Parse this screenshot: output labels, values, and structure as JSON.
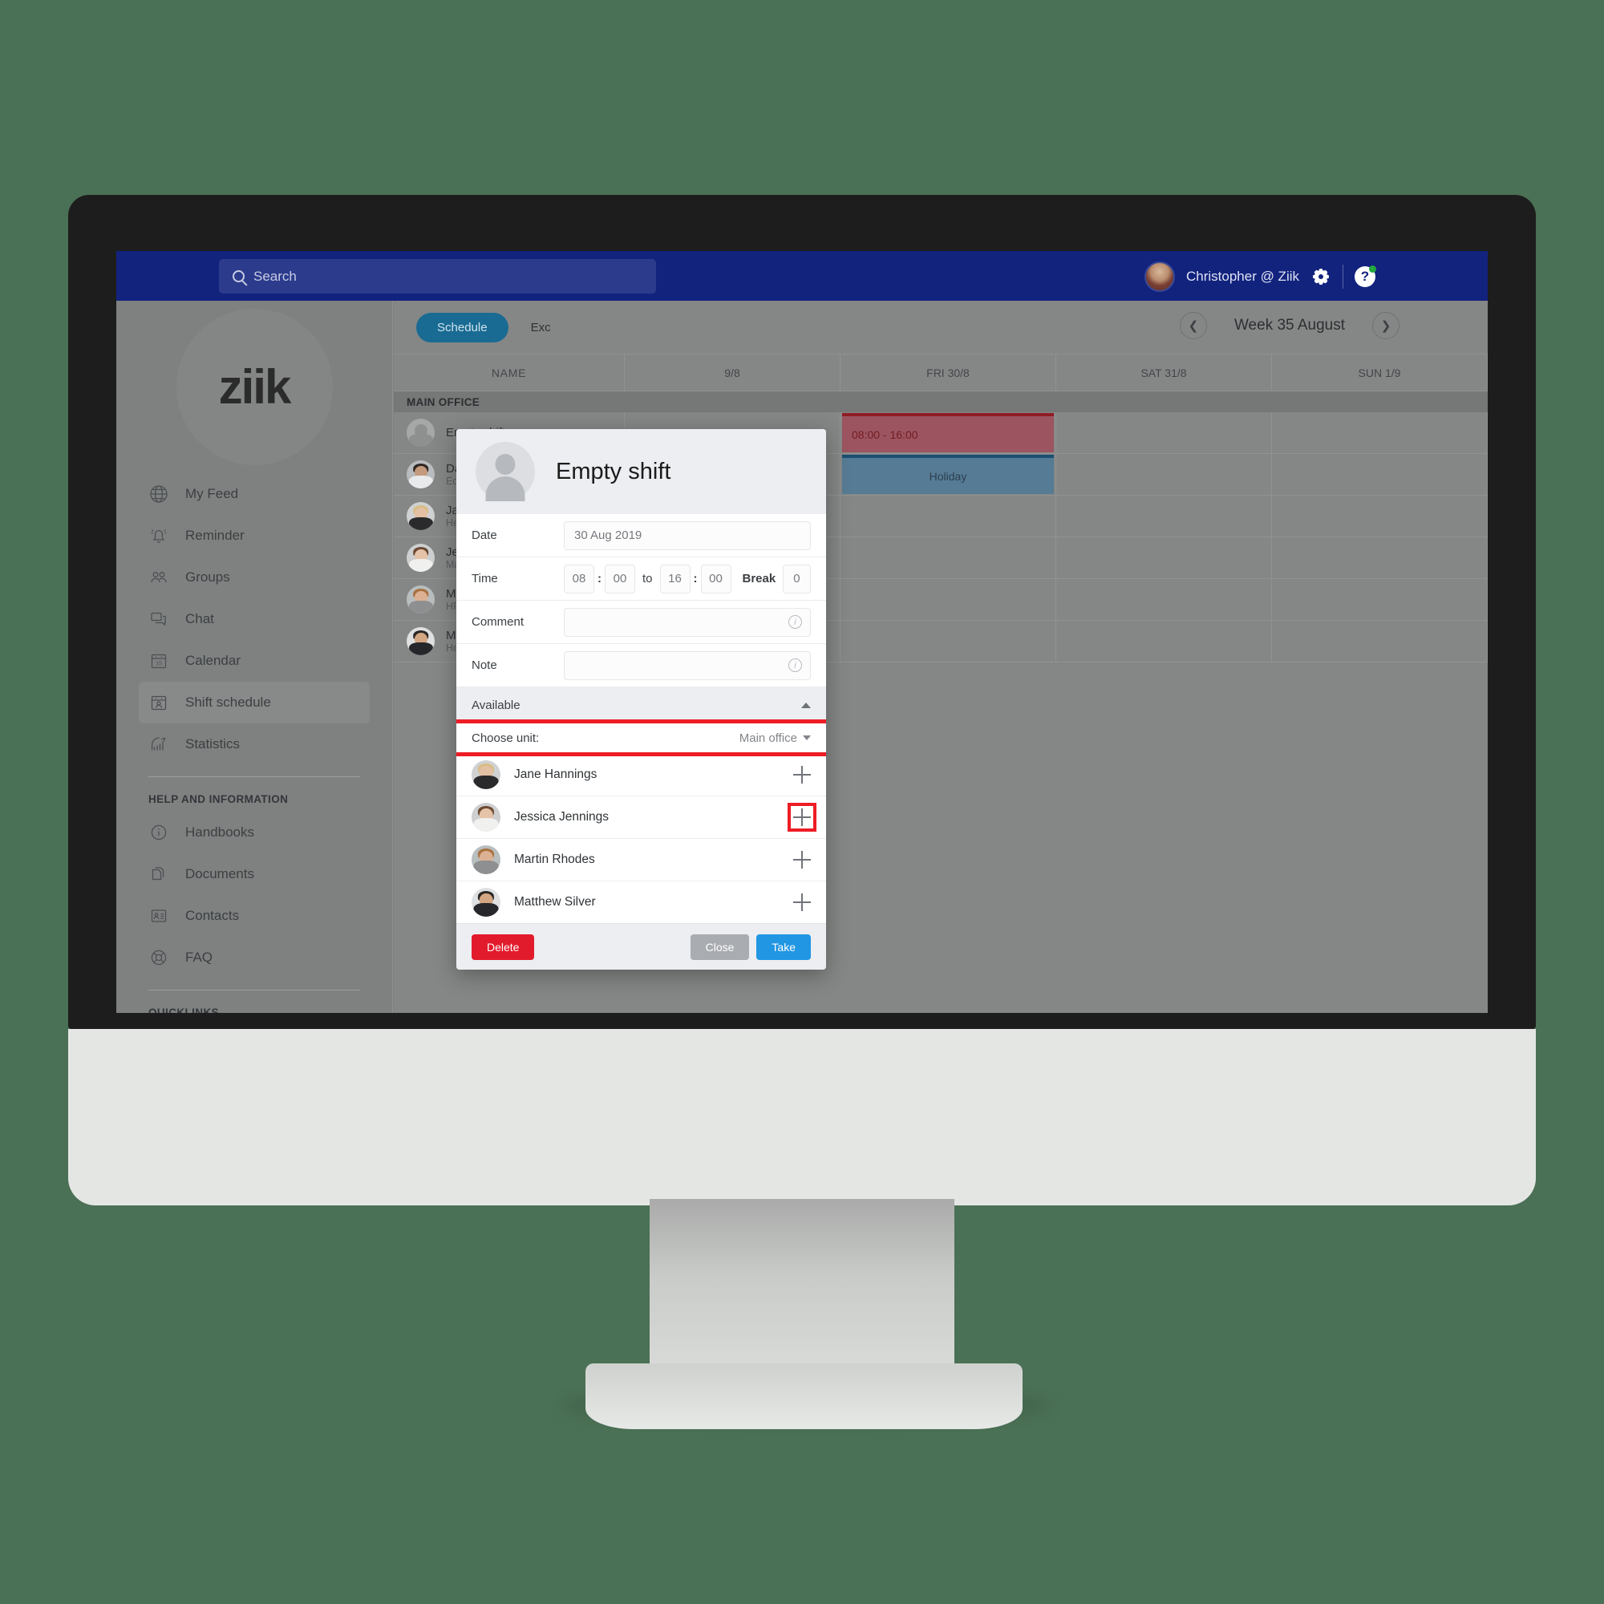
{
  "topbar": {
    "search_placeholder": "Search",
    "search_icon": "search-icon",
    "user_name": "Christopher @ Ziik",
    "gear_icon": "gear-icon",
    "help_icon": "help-icon",
    "help_glyph": "?"
  },
  "sidebar": {
    "logo": "ziik",
    "items": [
      {
        "label": "My Feed",
        "icon": "globe-icon"
      },
      {
        "label": "Reminder",
        "icon": "bell-icon"
      },
      {
        "label": "Groups",
        "icon": "people-icon"
      },
      {
        "label": "Chat",
        "icon": "chat-icon"
      },
      {
        "label": "Calendar",
        "icon": "calendar-icon",
        "day": "15"
      },
      {
        "label": "Shift schedule",
        "icon": "shift-schedule-icon"
      },
      {
        "label": "Statistics",
        "icon": "statistics-icon"
      }
    ],
    "help_section_title": "HELP AND INFORMATION",
    "help_items": [
      {
        "label": "Handbooks",
        "icon": "info-circle-icon"
      },
      {
        "label": "Documents",
        "icon": "documents-icon"
      },
      {
        "label": "Contacts",
        "icon": "contact-card-icon"
      },
      {
        "label": "FAQ",
        "icon": "lifebuoy-icon"
      }
    ],
    "quicklinks_title": "QUICKLINKS"
  },
  "toolbar": {
    "tab_schedule": "Schedule",
    "tab_exchange": "Exc",
    "prev_icon": "chevron-left-icon",
    "next_icon": "chevron-right-icon",
    "week_label": "Week 35 August"
  },
  "schedule": {
    "col_name": "NAME",
    "days": [
      "9/8",
      "FRI 30/8",
      "SAT 31/8",
      "SUN 1/9"
    ],
    "group_label": "MAIN OFFICE",
    "rows": [
      {
        "name": "Empty shift",
        "role": "",
        "avatar": "placeholder-avatar"
      },
      {
        "name": "Dan Yung",
        "role": "Economy",
        "avatar": "dan-yung-avatar"
      },
      {
        "name": "Jane Hannings",
        "role": "Head of sales",
        "avatar": "jane-hannings-avatar"
      },
      {
        "name": "Jessica Jennings",
        "role": "Marketing",
        "avatar": "jessica-jennings-avatar"
      },
      {
        "name": "Martin Rhodes",
        "role": "HR",
        "avatar": "martin-rhodes-avatar"
      },
      {
        "name": "Matthew Silver",
        "role": "Head of supplies",
        "avatar": "matthew-silver-avatar"
      }
    ],
    "shift_block": "08:00 - 16:00",
    "holiday_block": "Holiday"
  },
  "modal": {
    "title": "Empty shift",
    "avatar": "placeholder-avatar",
    "fields": {
      "date_label": "Date",
      "date_value": "30 Aug 2019",
      "time_label": "Time",
      "time_from_h": "08",
      "time_from_m": "00",
      "time_to_word": "to",
      "time_to_h": "16",
      "time_to_m": "00",
      "break_label": "Break",
      "break_value": "0",
      "comment_label": "Comment",
      "comment_value": "",
      "note_label": "Note",
      "note_value": ""
    },
    "available_label": "Available",
    "available_caret": "caret-up-icon",
    "unit_label": "Choose unit:",
    "unit_value": "Main office",
    "unit_caret": "caret-down-icon",
    "available_people": [
      {
        "name": "Jane Hannings",
        "avatar": "jane-hannings-avatar",
        "add_icon": "plus-icon"
      },
      {
        "name": "Jessica Jennings",
        "avatar": "jessica-jennings-avatar",
        "add_icon": "plus-icon"
      },
      {
        "name": "Martin Rhodes",
        "avatar": "martin-rhodes-avatar",
        "add_icon": "plus-icon"
      },
      {
        "name": "Matthew Silver",
        "avatar": "matthew-silver-avatar",
        "add_icon": "plus-icon"
      }
    ],
    "footer": {
      "delete_label": "Delete",
      "close_label": "Close",
      "take_label": "Take"
    }
  },
  "colors": {
    "header_blue": "#12237e",
    "accent_teal": "#1a6b93",
    "highlight_red": "#ee1c25",
    "delete_red": "#e21b2c",
    "take_blue": "#2196e3",
    "shift_red": "#9c5560",
    "holiday_blue": "#567b94",
    "page_background": "#4a7055"
  }
}
